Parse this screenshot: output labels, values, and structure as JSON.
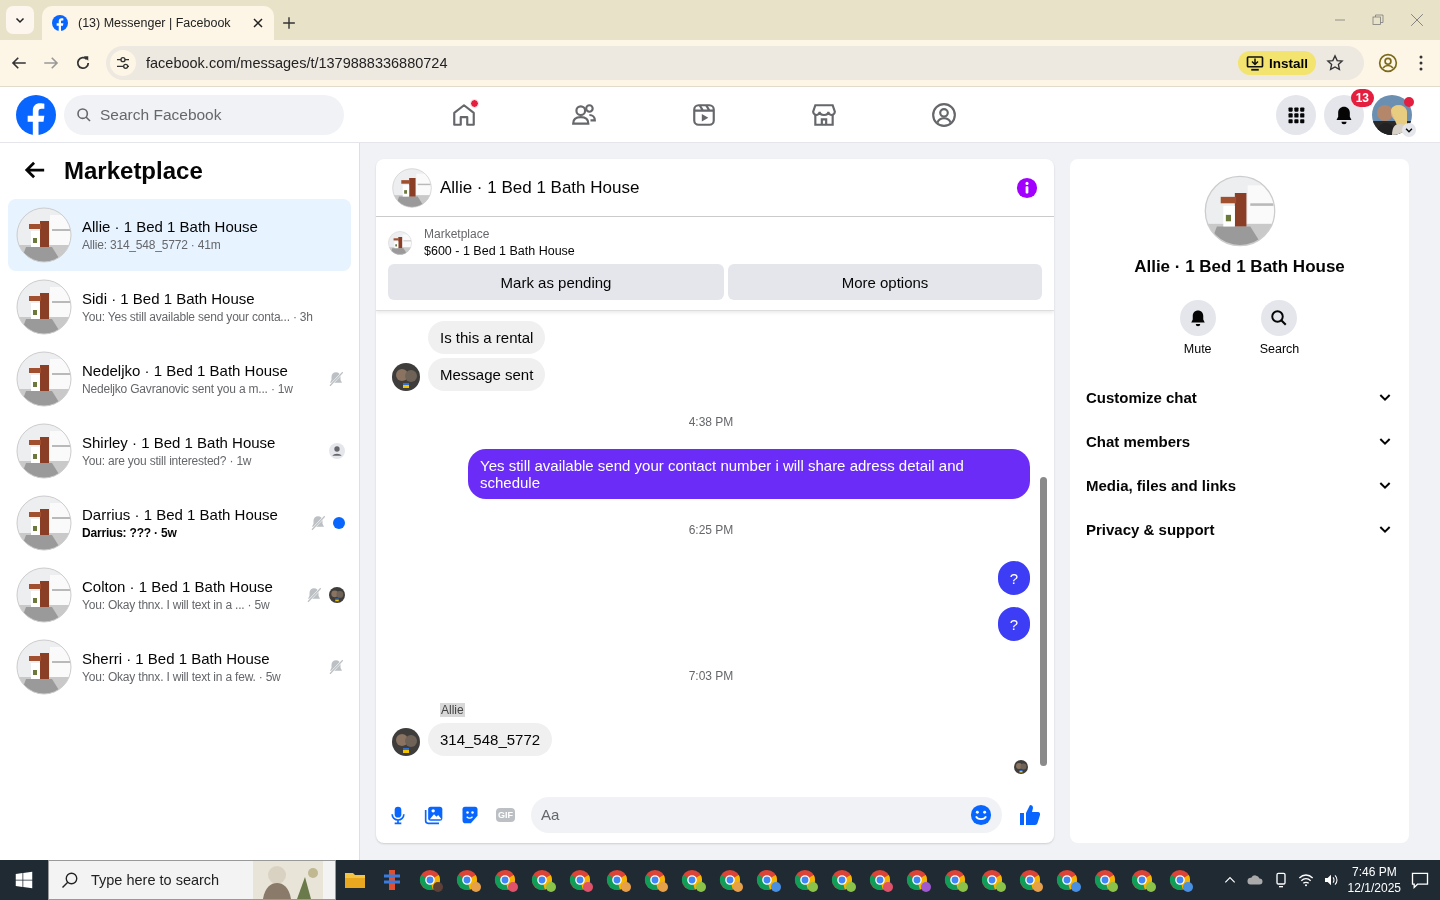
{
  "browser": {
    "tab_title": "(13) Messenger | Facebook",
    "url": "facebook.com/messages/t/1379888336880724",
    "install_label": "Install"
  },
  "header": {
    "search_placeholder": "Search Facebook",
    "nav": [
      {
        "kind": "home",
        "notification": true
      },
      {
        "kind": "friends",
        "notification": false
      },
      {
        "kind": "video",
        "notification": false
      },
      {
        "kind": "marketplace",
        "notification": false
      },
      {
        "kind": "groups",
        "notification": false
      }
    ],
    "notifications_count": "13"
  },
  "sidebar": {
    "title": "Marketplace",
    "conversations": [
      {
        "kind": "plain",
        "title": "Allie · 1 Bed 1 Bath House",
        "preview": "Allie: 314_548_5772 · 41m",
        "selected": true,
        "unread": false,
        "muted": false
      },
      {
        "kind": "plain",
        "title": "Sidi · 1 Bed 1 Bath House",
        "preview": "You: Yes still available send your conta... · 3h",
        "selected": false,
        "unread": false,
        "muted": false
      },
      {
        "kind": "plain",
        "title": "Nedeljko · 1 Bed 1 Bath House",
        "preview": "Nedeljko Gavranovic sent you a m... · 1w",
        "selected": false,
        "unread": false,
        "muted": true
      },
      {
        "kind": "seen",
        "title": "Shirley · 1 Bed 1 Bath House",
        "preview": "You: are you still interested? · 1w",
        "selected": false,
        "unread": false,
        "muted": false
      },
      {
        "kind": "dot",
        "title": "Darrius · 1 Bed 1 Bath House",
        "preview": "Darrius: ??? · 5w",
        "selected": false,
        "unread": true,
        "muted": true
      },
      {
        "kind": "avatar",
        "title": "Colton · 1 Bed 1 Bath House",
        "preview": "You: Okay thnx. I will text in a ... · 5w",
        "selected": false,
        "unread": false,
        "muted": true
      },
      {
        "kind": "plain",
        "title": "Sherri · 1 Bed 1 Bath House",
        "preview": "You: Okay thnx. I will text in a few. · 5w",
        "selected": false,
        "unread": false,
        "muted": true
      }
    ]
  },
  "chat": {
    "title": "Allie · 1 Bed 1 Bath House",
    "listing_label": "Marketplace",
    "listing": "$600 - 1 Bed 1 Bath House",
    "actions": [
      "Mark as pending",
      "More options"
    ],
    "messages": [
      {
        "kind": "incoming",
        "text": "Is this a rental",
        "avatar": false
      },
      {
        "kind": "incoming",
        "text": "Message sent",
        "avatar": true
      },
      {
        "kind": "time",
        "text": "4:38 PM"
      },
      {
        "kind": "outgoing",
        "text": "Yes still available send your contact number i will share adress detail and schedule",
        "color": "#6a2cf6"
      },
      {
        "kind": "time",
        "text": "6:25 PM"
      },
      {
        "kind": "outgoing",
        "text": "?",
        "color": "#3d3df5"
      },
      {
        "kind": "outgoing",
        "text": "?",
        "color": "#3d3df5"
      },
      {
        "kind": "time",
        "text": "7:03 PM"
      },
      {
        "kind": "incoming",
        "sender": "Allie",
        "text": "314_548_5772",
        "avatar": true
      }
    ],
    "composer": {
      "placeholder": "Aa",
      "gif_label": "GIF"
    }
  },
  "info": {
    "title": "Allie · 1 Bed 1 Bath House",
    "actions": [
      {
        "kind": "mute",
        "label": "Mute"
      },
      {
        "kind": "search",
        "label": "Search"
      }
    ],
    "sections": [
      {
        "label": "Customize chat",
        "expanded": false
      },
      {
        "label": "Chat members",
        "expanded": false
      },
      {
        "label": "Media, files and links",
        "expanded": false
      },
      {
        "label": "Privacy & support",
        "expanded": false
      }
    ]
  },
  "taskbar": {
    "search_placeholder": "Type here to search",
    "apps": [
      {
        "kind": "folder"
      },
      {
        "kind": "app"
      },
      {
        "kind": "browser",
        "color": "#5d4037"
      },
      {
        "kind": "browser",
        "color": "#e6a04a"
      },
      {
        "kind": "browser",
        "color": "#e0526a"
      },
      {
        "kind": "browser",
        "color": "#8bc34a"
      },
      {
        "kind": "browser",
        "color": "#e0526a"
      },
      {
        "kind": "browser",
        "color": "#e6a04a"
      },
      {
        "kind": "browser",
        "color": "#e6a04a"
      },
      {
        "kind": "browser",
        "color": "#8bc34a"
      },
      {
        "kind": "browser",
        "color": "#e6a04a"
      },
      {
        "kind": "browser",
        "color": "#4a90e2"
      },
      {
        "kind": "browser",
        "color": "#8bc34a"
      },
      {
        "kind": "browser",
        "color": "#8bc34a"
      },
      {
        "kind": "browser",
        "color": "#e0526a"
      },
      {
        "kind": "browser",
        "color": "#a05ad0"
      },
      {
        "kind": "browser",
        "color": "#8bc34a"
      },
      {
        "kind": "browser",
        "color": "#8bc34a"
      },
      {
        "kind": "browser",
        "color": "#e6a04a"
      },
      {
        "kind": "browser",
        "color": "#4a90e2"
      },
      {
        "kind": "browser",
        "color": "#8bc34a"
      },
      {
        "kind": "browser",
        "color": "#8bc34a"
      },
      {
        "kind": "browser",
        "color": "#4a90e2"
      }
    ],
    "time": "7:46 PM",
    "date": "12/1/2025"
  }
}
